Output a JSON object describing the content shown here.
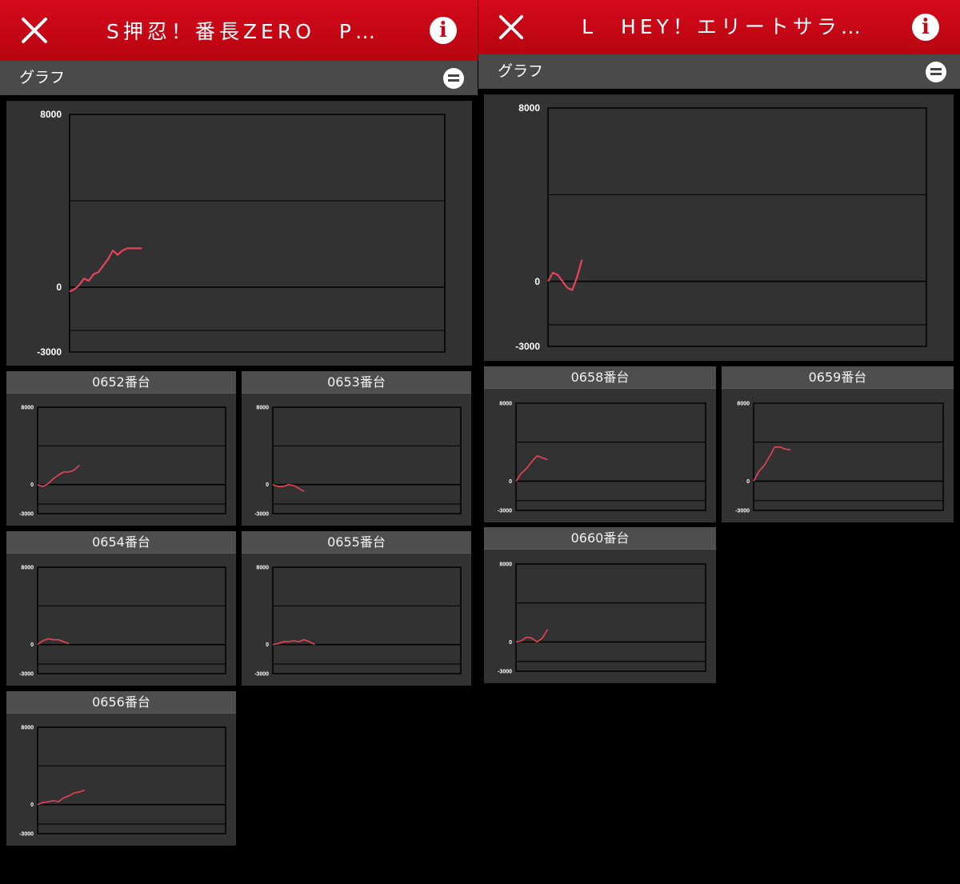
{
  "colors": {
    "header_red": "#cc0818",
    "line": "#e8435a",
    "plot_bg": "#333333"
  },
  "panels": [
    {
      "title": "S押忍！番長ZERO　P…",
      "close_icon": "close-icon",
      "info_icon": "info-icon",
      "info_glyph": "i",
      "section_label": "グラフ",
      "collapse_icon": "collapse-icon",
      "charts": [
        {
          "caption": "",
          "ymax": "8000",
          "yzero": "0",
          "ymin": "-3000"
        },
        {
          "caption": "0652番台",
          "ymax": "8000",
          "yzero": "0",
          "ymin": "-3000"
        },
        {
          "caption": "0653番台",
          "ymax": "8000",
          "yzero": "0",
          "ymin": "-3000"
        },
        {
          "caption": "0654番台",
          "ymax": "8000",
          "yzero": "0",
          "ymin": "-3000"
        },
        {
          "caption": "0655番台",
          "ymax": "8000",
          "yzero": "0",
          "ymin": "-3000"
        },
        {
          "caption": "0656番台",
          "ymax": "8000",
          "yzero": "0",
          "ymin": "-3000"
        }
      ]
    },
    {
      "title": "L　HEY！エリートサラ…",
      "close_icon": "close-icon",
      "info_icon": "info-icon",
      "info_glyph": "i",
      "section_label": "グラフ",
      "collapse_icon": "collapse-icon",
      "charts": [
        {
          "caption": "",
          "ymax": "8000",
          "yzero": "0",
          "ymin": "-3000"
        },
        {
          "caption": "0658番台",
          "ymax": "8000",
          "yzero": "0",
          "ymin": "-3000"
        },
        {
          "caption": "0659番台",
          "ymax": "8000",
          "yzero": "0",
          "ymin": "-3000"
        },
        {
          "caption": "0660番台",
          "ymax": "8000",
          "yzero": "0",
          "ymin": "-3000"
        }
      ]
    }
  ],
  "chart_data": [
    {
      "type": "line",
      "title": "",
      "ylim": [
        -3000,
        8000
      ],
      "gridlines": [
        -3000,
        -2000,
        0,
        4000,
        8000
      ],
      "x": [
        0,
        1,
        2,
        3,
        4,
        5,
        6,
        7,
        8,
        9,
        10,
        11,
        12,
        13,
        14,
        15
      ],
      "series": [
        {
          "values": [
            -200,
            -100,
            100,
            400,
            300,
            600,
            700,
            1000,
            1300,
            1700,
            1500,
            1700,
            1800,
            1800,
            1800,
            1800
          ]
        }
      ]
    },
    {
      "type": "line",
      "title": "0652番台",
      "ylim": [
        -3000,
        8000
      ],
      "gridlines": [
        -3000,
        -2000,
        0,
        4000,
        8000
      ],
      "x": [
        0,
        1,
        2,
        3,
        4,
        5,
        6,
        7,
        8
      ],
      "series": [
        {
          "values": [
            0,
            -200,
            100,
            600,
            1000,
            1300,
            1300,
            1500,
            2000
          ]
        }
      ]
    },
    {
      "type": "line",
      "title": "0653番台",
      "ylim": [
        -3000,
        8000
      ],
      "gridlines": [
        -3000,
        -2000,
        0,
        4000,
        8000
      ],
      "x": [
        0,
        1,
        2,
        3,
        4,
        5,
        6
      ],
      "series": [
        {
          "values": [
            0,
            -200,
            -200,
            0,
            -100,
            -400,
            -700
          ]
        }
      ]
    },
    {
      "type": "line",
      "title": "0654番台",
      "ylim": [
        -3000,
        8000
      ],
      "gridlines": [
        -3000,
        -2000,
        0,
        4000,
        8000
      ],
      "x": [
        0,
        1,
        2,
        3,
        4,
        5,
        6
      ],
      "series": [
        {
          "values": [
            0,
            400,
            600,
            500,
            500,
            300,
            100
          ]
        }
      ]
    },
    {
      "type": "line",
      "title": "0655番台",
      "ylim": [
        -3000,
        8000
      ],
      "gridlines": [
        -3000,
        -2000,
        0,
        4000,
        8000
      ],
      "x": [
        0,
        1,
        2,
        3,
        4,
        5,
        6,
        7,
        8
      ],
      "series": [
        {
          "values": [
            0,
            100,
            300,
            300,
            400,
            300,
            500,
            300,
            0
          ]
        }
      ]
    },
    {
      "type": "line",
      "title": "0656番台",
      "ylim": [
        -3000,
        8000
      ],
      "gridlines": [
        -3000,
        -2000,
        0,
        4000,
        8000
      ],
      "x": [
        0,
        1,
        2,
        3,
        4,
        5,
        6,
        7,
        8,
        9
      ],
      "series": [
        {
          "values": [
            0,
            200,
            300,
            400,
            300,
            700,
            900,
            1200,
            1300,
            1500
          ]
        }
      ]
    },
    {
      "type": "line",
      "title": "",
      "ylim": [
        -3000,
        8000
      ],
      "gridlines": [
        -3000,
        -2000,
        0,
        4000,
        8000
      ],
      "x": [
        0,
        1,
        2,
        3,
        4,
        5,
        6,
        7
      ],
      "series": [
        {
          "values": [
            0,
            400,
            300,
            0,
            -300,
            -400,
            200,
            1000
          ]
        }
      ]
    },
    {
      "type": "line",
      "title": "0658番台",
      "ylim": [
        -3000,
        8000
      ],
      "gridlines": [
        -3000,
        -2000,
        0,
        4000,
        8000
      ],
      "x": [
        0,
        1,
        2,
        3,
        4,
        5,
        6
      ],
      "series": [
        {
          "values": [
            0,
            800,
            1300,
            2000,
            2600,
            2400,
            2200
          ]
        }
      ]
    },
    {
      "type": "line",
      "title": "0659番台",
      "ylim": [
        -3000,
        8000
      ],
      "gridlines": [
        -3000,
        -2000,
        0,
        4000,
        8000
      ],
      "x": [
        0,
        1,
        2,
        3,
        4,
        5,
        6,
        7
      ],
      "series": [
        {
          "values": [
            0,
            1000,
            1600,
            2500,
            3500,
            3500,
            3300,
            3200
          ]
        }
      ]
    },
    {
      "type": "line",
      "title": "0660番台",
      "ylim": [
        -3000,
        8000
      ],
      "gridlines": [
        -3000,
        -2000,
        0,
        4000,
        8000
      ],
      "x": [
        0,
        1,
        2,
        3,
        4,
        5,
        6
      ],
      "series": [
        {
          "values": [
            0,
            100,
            500,
            400,
            0,
            400,
            1300
          ]
        }
      ]
    }
  ]
}
